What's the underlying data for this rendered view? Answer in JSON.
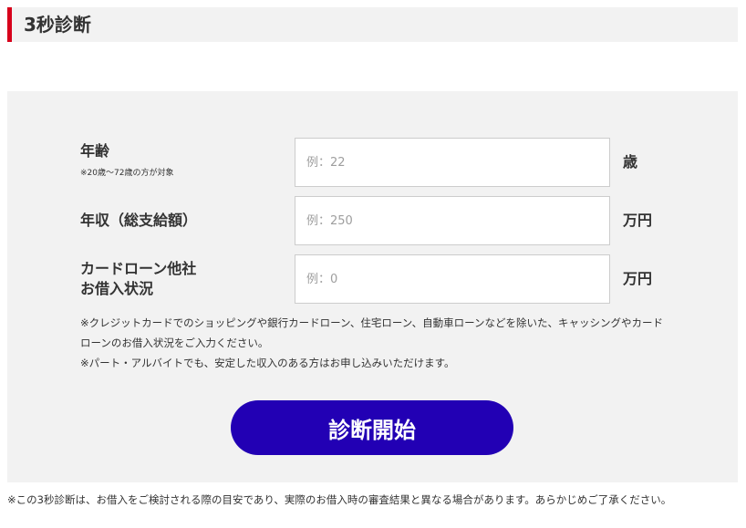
{
  "header": {
    "title": "3秒診断"
  },
  "form": {
    "age": {
      "label": "年齢",
      "note": "※20歳〜72歳の方が対象",
      "placeholder": "例：22",
      "value": "",
      "unit": "歳"
    },
    "income": {
      "label": "年収（総支給額）",
      "placeholder": "例：250",
      "value": "",
      "unit": "万円"
    },
    "loans": {
      "label_line1": "カードローン他社",
      "label_line2": "お借入状況",
      "placeholder": "例：0",
      "value": "",
      "unit": "万円"
    },
    "notes": [
      "※クレジットカードでのショッピングや銀行カードローン、住宅ローン、自動車ローンなどを除いた、キャッシングやカードローンのお借入状況をご入力ください。",
      "※パート・アルバイトでも、安定した収入のある方はお申し込みいただけます。"
    ],
    "submit_label": "診断開始"
  },
  "disclaimer": "※この3秒診断は、お借入をご検討される際の目安であり、実際のお借入時の審査結果と異なる場合があります。あらかじめご了承ください。",
  "colors": {
    "accent": "#d7001b",
    "button": "#2200b4",
    "panel_bg": "#f2f2f2"
  }
}
